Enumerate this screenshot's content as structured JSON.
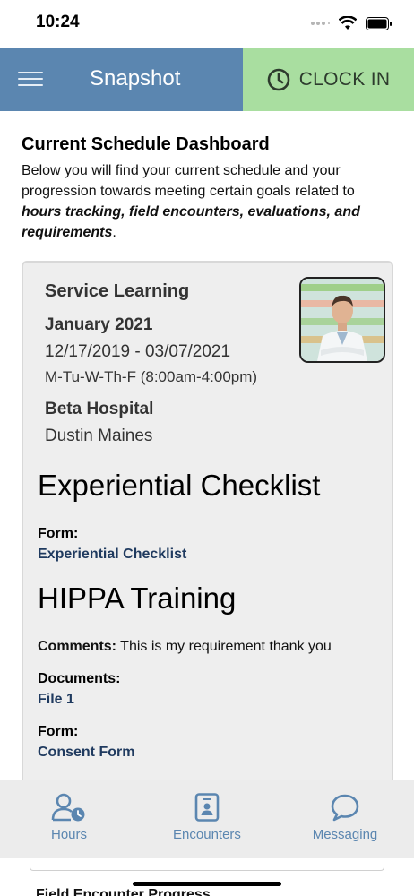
{
  "status_bar": {
    "time": "10:24"
  },
  "header": {
    "title": "Snapshot",
    "clock_in_label": "CLOCK IN"
  },
  "dashboard": {
    "title": "Current Schedule Dashboard",
    "desc_plain": "Below you will find your current schedule and your progression towards meeting certain goals related to ",
    "desc_emph": "hours tracking, field encounters, evaluations, and requirements",
    "desc_end": "."
  },
  "schedule": {
    "title": "Service Learning",
    "month": "January 2021",
    "dates": "12/17/2019 - 03/07/2021",
    "hours": "M-Tu-W-Th-F (8:00am-4:00pm)",
    "site": "Beta Hospital",
    "preceptor": "Dustin Maines"
  },
  "experiential": {
    "heading": "Experiential Checklist",
    "form_label": "Form:",
    "form_link": "Experiential Checklist"
  },
  "hippa": {
    "heading": "HIPPA Training",
    "comments_label": "Comments:",
    "comments_value": " This is my requirement thank you",
    "documents_label": "Documents:",
    "document_link": "File 1",
    "form_label": "Form:",
    "form_link": "Consent Form"
  },
  "tabs": [
    {
      "label": "Hours",
      "icon": "user-clock-icon"
    },
    {
      "label": "Encounters",
      "icon": "badge-icon"
    },
    {
      "label": "Messaging",
      "icon": "chat-bubble-icon"
    }
  ],
  "below": {
    "partial_text": "Field Encounter Progress"
  },
  "colors": {
    "header_blue": "#5b86b0",
    "clock_in_green": "#a9dea0",
    "link_navy": "#1f3a5f"
  }
}
